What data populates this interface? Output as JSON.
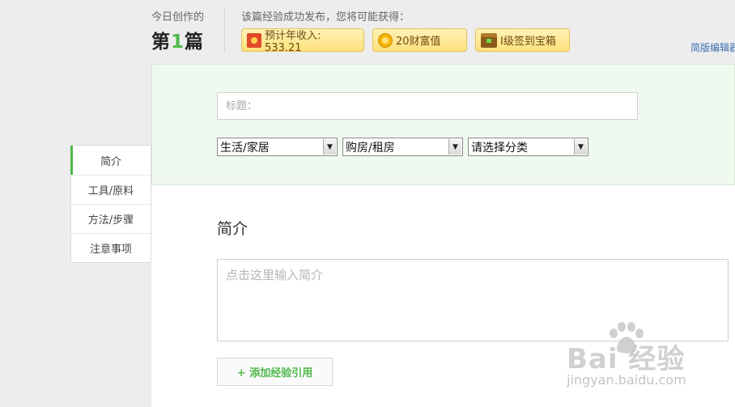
{
  "header": {
    "today_label": "今日创作的",
    "count_prefix": "第",
    "count_number": "1",
    "count_suffix": "篇",
    "reward_intro": "该篇经验成功发布，您将可能获得：",
    "rewards": [
      {
        "icon": "red-envelope-icon",
        "label": "预计年收入: 533.21"
      },
      {
        "icon": "gold-coin-icon",
        "label": "20财富值"
      },
      {
        "icon": "treasure-chest-icon",
        "label": "I级签到宝箱"
      }
    ],
    "simple_editor_link": "简版编辑器"
  },
  "form": {
    "title_placeholder": "标题：",
    "category_selects": [
      {
        "selected": "生活/家居"
      },
      {
        "selected": "购房/租房"
      },
      {
        "selected": "请选择分类"
      }
    ]
  },
  "sidebar": {
    "items": [
      {
        "label": "简介",
        "active": true
      },
      {
        "label": "工具/原料"
      },
      {
        "label": "方法/步骤"
      },
      {
        "label": "注意事项"
      }
    ]
  },
  "main": {
    "section_title": "简介",
    "summary_placeholder": "点击这里输入简介",
    "add_reference_label": "+ 添加经验引用"
  },
  "watermark": {
    "brand": "Bai  经验",
    "url": "jingyan.baidu.com"
  },
  "colors": {
    "accent_green": "#4fb84c",
    "panel_green": "#f0f9ef",
    "reward_gold": "#ffe07a",
    "link_blue": "#3a6fb0"
  }
}
